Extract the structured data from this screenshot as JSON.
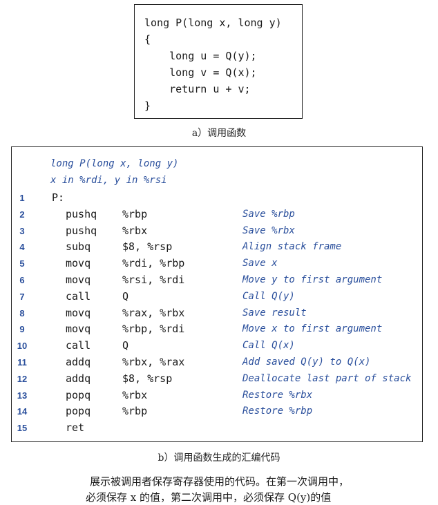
{
  "figure_a": {
    "code_lines": [
      "long P(long x, long y)",
      "{",
      "    long u = Q(y);",
      "    long v = Q(x);",
      "    return u + v;",
      "}"
    ],
    "caption": "a）调用函数"
  },
  "figure_b": {
    "header_lines": [
      "long P(long x, long y)",
      "x in %rdi, y in %rsi"
    ],
    "lines": [
      {
        "num": "1",
        "label": "P:",
        "instr": "",
        "ops": "",
        "comment": ""
      },
      {
        "num": "2",
        "label": "",
        "instr": "pushq",
        "ops": "%rbp",
        "comment": "Save %rbp"
      },
      {
        "num": "3",
        "label": "",
        "instr": "pushq",
        "ops": "%rbx",
        "comment": "Save %rbx"
      },
      {
        "num": "4",
        "label": "",
        "instr": "subq",
        "ops": "$8, %rsp",
        "comment": "Align stack frame"
      },
      {
        "num": "5",
        "label": "",
        "instr": "movq",
        "ops": "%rdi, %rbp",
        "comment": "Save x"
      },
      {
        "num": "6",
        "label": "",
        "instr": "movq",
        "ops": "%rsi, %rdi",
        "comment": "Move y to first argument"
      },
      {
        "num": "7",
        "label": "",
        "instr": "call",
        "ops": "Q",
        "comment": "Call Q(y)"
      },
      {
        "num": "8",
        "label": "",
        "instr": "movq",
        "ops": "%rax, %rbx",
        "comment": "Save result"
      },
      {
        "num": "9",
        "label": "",
        "instr": "movq",
        "ops": "%rbp, %rdi",
        "comment": "Move x to first argument"
      },
      {
        "num": "10",
        "label": "",
        "instr": "call",
        "ops": "Q",
        "comment": "Call Q(x)"
      },
      {
        "num": "11",
        "label": "",
        "instr": "addq",
        "ops": "%rbx, %rax",
        "comment": "Add saved Q(y) to Q(x)"
      },
      {
        "num": "12",
        "label": "",
        "instr": "addq",
        "ops": "$8, %rsp",
        "comment": "Deallocate last part of stack"
      },
      {
        "num": "13",
        "label": "",
        "instr": "popq",
        "ops": "%rbx",
        "comment": "Restore %rbx"
      },
      {
        "num": "14",
        "label": "",
        "instr": "popq",
        "ops": "%rbp",
        "comment": "Restore %rbp"
      },
      {
        "num": "15",
        "label": "",
        "instr": "ret",
        "ops": "",
        "comment": ""
      }
    ],
    "caption": "b）调用函数生成的汇编代码"
  },
  "description": {
    "line1": "展示被调用者保存寄存器使用的代码。在第一次调用中，",
    "line2": "必须保存 x 的值，第二次调用中，必须保存 Q(y)的值"
  },
  "colors": {
    "accent_blue": "#2a4f9c",
    "text": "#1a1a1a"
  }
}
